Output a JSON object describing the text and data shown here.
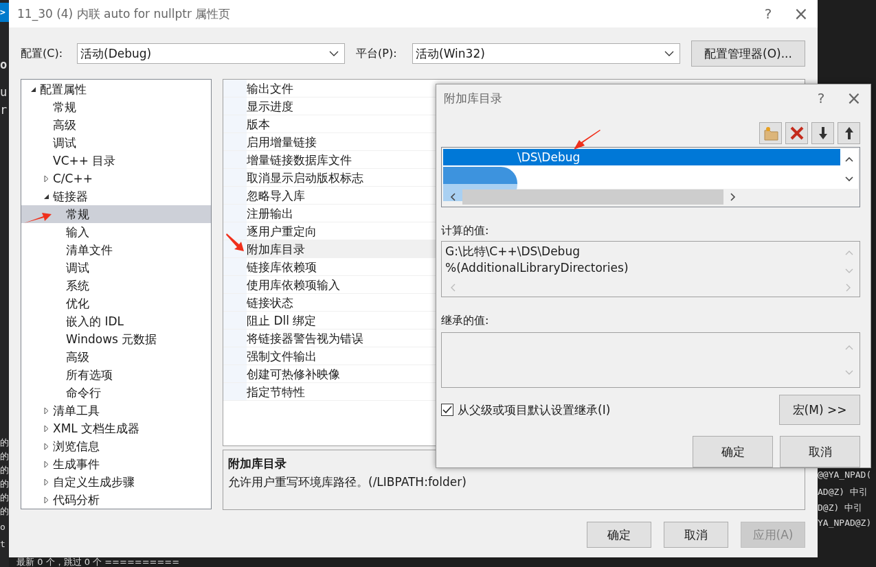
{
  "background": {
    "left_lines": [
      ">",
      "o",
      "u",
      "r",
      "的",
      "的",
      "的",
      "的",
      "的",
      "的",
      "o",
      "t"
    ],
    "right_lines": [
      "@@YA_NPAD(",
      "AD@Z) 中引",
      "D@Z) 中引",
      "YA_NPAD@Z)"
    ],
    "bottom_line": "最新 0 个，跳过 0 个 =========="
  },
  "window": {
    "title": "11_30 (4) 内联 auto for nullptr 属性页",
    "help": "?",
    "close": "×"
  },
  "config": {
    "label": "配置(C):",
    "value": "活动(Debug)"
  },
  "platform": {
    "label": "平台(P):",
    "value": "活动(Win32)"
  },
  "config_manager_button": "配置管理器(O)...",
  "tree": [
    {
      "label": "配置属性",
      "expanded": true,
      "selected": false,
      "children": [
        {
          "label": "常规",
          "selected": false
        },
        {
          "label": "高级",
          "selected": false
        },
        {
          "label": "调试",
          "selected": false
        },
        {
          "label": "VC++ 目录",
          "selected": false
        },
        {
          "label": "C/C++",
          "expanded": false,
          "selected": false
        },
        {
          "label": "链接器",
          "expanded": true,
          "selected": false,
          "children": [
            {
              "label": "常规",
              "selected": true
            },
            {
              "label": "输入",
              "selected": false
            },
            {
              "label": "清单文件",
              "selected": false
            },
            {
              "label": "调试",
              "selected": false
            },
            {
              "label": "系统",
              "selected": false
            },
            {
              "label": "优化",
              "selected": false
            },
            {
              "label": "嵌入的 IDL",
              "selected": false
            },
            {
              "label": "Windows 元数据",
              "selected": false
            },
            {
              "label": "高级",
              "selected": false
            },
            {
              "label": "所有选项",
              "selected": false
            },
            {
              "label": "命令行",
              "selected": false
            }
          ]
        },
        {
          "label": "清单工具",
          "expanded": false,
          "selected": false
        },
        {
          "label": "XML 文档生成器",
          "expanded": false,
          "selected": false
        },
        {
          "label": "浏览信息",
          "expanded": false,
          "selected": false
        },
        {
          "label": "生成事件",
          "expanded": false,
          "selected": false
        },
        {
          "label": "自定义生成步骤",
          "expanded": false,
          "selected": false
        },
        {
          "label": "代码分析",
          "expanded": false,
          "selected": false
        }
      ]
    }
  ],
  "properties": [
    {
      "name": "输出文件",
      "selected": false
    },
    {
      "name": "显示进度",
      "selected": false
    },
    {
      "name": "版本",
      "selected": false
    },
    {
      "name": "启用增量链接",
      "selected": false
    },
    {
      "name": "增量链接数据库文件",
      "selected": false
    },
    {
      "name": "取消显示启动版权标志",
      "selected": false
    },
    {
      "name": "忽略导入库",
      "selected": false
    },
    {
      "name": "注册输出",
      "selected": false
    },
    {
      "name": "逐用户重定向",
      "selected": false
    },
    {
      "name": "附加库目录",
      "selected": true
    },
    {
      "name": "链接库依赖项",
      "selected": false
    },
    {
      "name": "使用库依赖项输入",
      "selected": false
    },
    {
      "name": "链接状态",
      "selected": false
    },
    {
      "name": "阻止 Dll 绑定",
      "selected": false
    },
    {
      "name": "将链接器警告视为错误",
      "selected": false
    },
    {
      "name": "强制文件输出",
      "selected": false
    },
    {
      "name": "创建可热修补映像",
      "selected": false
    },
    {
      "name": "指定节特性",
      "selected": false
    }
  ],
  "description": {
    "title": "附加库目录",
    "text": "允许用户重写环境库路径。(/LIBPATH:folder)"
  },
  "buttons": [
    {
      "label": "确定",
      "disabled": false
    },
    {
      "label": "取消",
      "disabled": false
    },
    {
      "label": "应用(A)",
      "disabled": true
    }
  ],
  "sub_dialog": {
    "title": "附加库目录",
    "help": "?",
    "close": "×",
    "entries": [
      {
        "text": "\\DS\\Debug",
        "redacted": true,
        "selected": true
      }
    ],
    "evaluated_label": "计算的值:",
    "evaluated_lines": [
      "G:\\比特\\C++\\DS\\Debug",
      "%(AdditionalLibraryDirectories)"
    ],
    "inherited_label": "继承的值:",
    "inherit": {
      "label": "从父级或项目默认设置继承(I)",
      "checked": true
    },
    "macro_button": "宏(M) >>",
    "buttons": [
      "确定",
      "取消"
    ]
  }
}
